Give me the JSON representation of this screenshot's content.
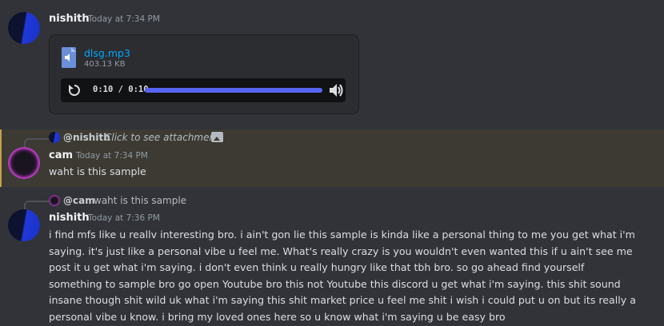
{
  "messages": {
    "first": {
      "author": "nishith",
      "timestamp": "Today at 7:34 PM",
      "attachment": {
        "file_name": "dlsg.mp3",
        "file_size": "403.13 KB",
        "time_display": "0:10 / 0:10",
        "progress": 1.0
      }
    },
    "second": {
      "reply_to": {
        "mention": "@nishith",
        "text": "Click to see attachment"
      },
      "author": "cam",
      "timestamp": "Today at 7:34 PM",
      "text": "waht is this sample"
    },
    "third": {
      "reply_to": {
        "mention": "@cam",
        "text": "waht is this sample"
      },
      "author": "nishith",
      "timestamp": "Today at 7:36 PM",
      "text": "i find mfs like u reallv interesting bro. i ain't gon lie this sample is kinda like a personal thing to me you get what i'm saying. it's just like a personal vibe u feel me. What's really crazy is you wouldn't even wanted this if u ain't see me post it u get what i'm saying. i don't even think u really hungry like that tbh bro. so go ahead find yourself something to sample bro go open Youtube bro this not Youtube this discord u get what i'm saying. this shit sound insane though shit wild uk what i'm saying this shit market price u feel me shit i wish i could put u on but its really a personal vibe u know. i bring my loved ones here so u know what i'm saying u be easy bro"
    }
  },
  "colors": {
    "background": "#313338",
    "highlight": "#3c3a33",
    "accent": "#5865f2",
    "link": "#00a8fc"
  },
  "icons": [
    "file-audio-icon",
    "replay-icon",
    "volume-icon",
    "image-icon"
  ]
}
